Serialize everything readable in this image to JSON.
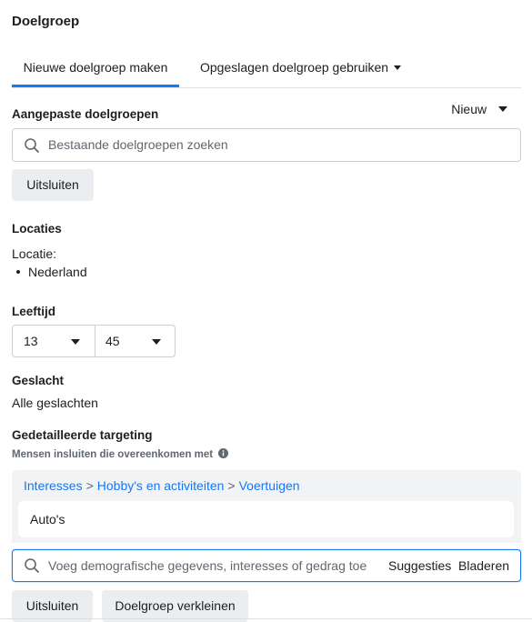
{
  "section_title": "Doelgroep",
  "tabs": [
    {
      "label": "Nieuwe doelgroep maken"
    },
    {
      "label": "Opgeslagen doelgroep gebruiken"
    }
  ],
  "custom_audiences": {
    "label": "Aangepaste doelgroepen",
    "new_label": "Nieuw",
    "search_placeholder": "Bestaande doelgroepen zoeken",
    "exclude_label": "Uitsluiten"
  },
  "locations": {
    "label": "Locaties",
    "sub_label": "Locatie:",
    "items": [
      "Nederland"
    ]
  },
  "age": {
    "label": "Leeftijd",
    "min": "13",
    "max": "45"
  },
  "gender": {
    "label": "Geslacht",
    "value": "Alle geslachten"
  },
  "detailed_targeting": {
    "label": "Gedetailleerde targeting",
    "include_label": "Mensen insluiten die overeenkomen met",
    "breadcrumb": [
      "Interesses",
      "Hobby's en activiteiten",
      "Voertuigen"
    ],
    "breadcrumb_separator": ">",
    "selected_items": [
      "Auto's"
    ],
    "search_placeholder": "Voeg demografische gegevens, interesses of gedrag toe",
    "suggestions_label": "Suggesties",
    "browse_label": "Bladeren",
    "exclude_label": "Uitsluiten",
    "narrow_label": "Doelgroep verkleinen"
  },
  "colors": {
    "accent": "#1877f2",
    "text": "#1c1e21",
    "secondary_text": "#606770",
    "button_bg": "#ebedf0",
    "panel_bg": "#f2f3f5",
    "border": "#ccd0d5"
  }
}
